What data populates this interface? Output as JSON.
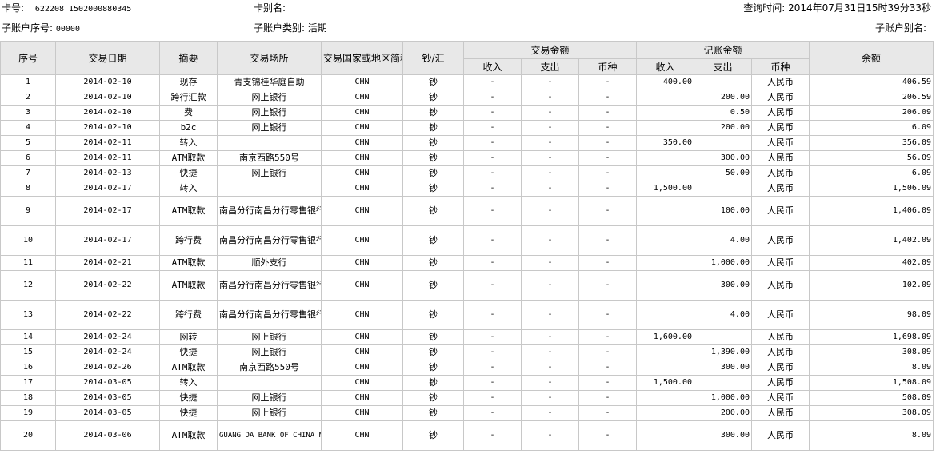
{
  "header": {
    "card_no_label": "卡号:",
    "card_no_value": "622208 1502000880345",
    "card_alias_label": "卡别名:",
    "card_alias_value": "",
    "query_time_label": "查询时间:",
    "query_time_value": "2014年07月31日15时39分33秒",
    "sub_account_no_label": "子账户序号:",
    "sub_account_no_value": "00000",
    "sub_account_type_label": "子账户类别:",
    "sub_account_type_value": "活期",
    "sub_account_alias_label": "子账户别名:",
    "sub_account_alias_value": ""
  },
  "columns": {
    "seq": "序号",
    "date": "交易日期",
    "summary": "摘要",
    "location": "交易场所",
    "country": "交易国家或地区简称",
    "cash_remit": "钞/汇",
    "trade_amount": "交易金额",
    "booked_amount": "记账金额",
    "income": "收入",
    "expense": "支出",
    "currency": "币种",
    "balance": "余额"
  },
  "rows": [
    {
      "seq": "1",
      "date": "2014-02-10",
      "summary": "现存",
      "location": "青支锦桂华庭自助",
      "country": "CHN",
      "cr": "钞",
      "t_in": "-",
      "t_out": "-",
      "t_cur": "-",
      "b_in": "400.00",
      "b_out": "",
      "b_cur": "人民币",
      "balance": "406.59",
      "tall": false
    },
    {
      "seq": "2",
      "date": "2014-02-10",
      "summary": "跨行汇款",
      "location": "网上银行",
      "country": "CHN",
      "cr": "钞",
      "t_in": "-",
      "t_out": "-",
      "t_cur": "-",
      "b_in": "",
      "b_out": "200.00",
      "b_cur": "人民币",
      "balance": "206.59",
      "tall": false
    },
    {
      "seq": "3",
      "date": "2014-02-10",
      "summary": "费",
      "location": "网上银行",
      "country": "CHN",
      "cr": "钞",
      "t_in": "-",
      "t_out": "-",
      "t_cur": "-",
      "b_in": "",
      "b_out": "0.50",
      "b_cur": "人民币",
      "balance": "206.09",
      "tall": false
    },
    {
      "seq": "4",
      "date": "2014-02-10",
      "summary": "b2c",
      "location": "网上银行",
      "country": "CHN",
      "cr": "钞",
      "t_in": "-",
      "t_out": "-",
      "t_cur": "-",
      "b_in": "",
      "b_out": "200.00",
      "b_cur": "人民币",
      "balance": "6.09",
      "tall": false
    },
    {
      "seq": "5",
      "date": "2014-02-11",
      "summary": "转入",
      "location": "",
      "country": "CHN",
      "cr": "钞",
      "t_in": "-",
      "t_out": "-",
      "t_cur": "-",
      "b_in": "350.00",
      "b_out": "",
      "b_cur": "人民币",
      "balance": "356.09",
      "tall": false
    },
    {
      "seq": "6",
      "date": "2014-02-11",
      "summary": "ATM取款",
      "location": "南京西路550号",
      "country": "CHN",
      "cr": "钞",
      "t_in": "-",
      "t_out": "-",
      "t_cur": "-",
      "b_in": "",
      "b_out": "300.00",
      "b_cur": "人民币",
      "balance": "56.09",
      "tall": false
    },
    {
      "seq": "7",
      "date": "2014-02-13",
      "summary": "快捷",
      "location": "网上银行",
      "country": "CHN",
      "cr": "钞",
      "t_in": "-",
      "t_out": "-",
      "t_cur": "-",
      "b_in": "",
      "b_out": "50.00",
      "b_cur": "人民币",
      "balance": "6.09",
      "tall": false
    },
    {
      "seq": "8",
      "date": "2014-02-17",
      "summary": "转入",
      "location": "",
      "country": "CHN",
      "cr": "钞",
      "t_in": "-",
      "t_out": "-",
      "t_cur": "-",
      "b_in": "1,500.00",
      "b_out": "",
      "b_cur": "人民币",
      "balance": "1,506.09",
      "tall": false
    },
    {
      "seq": "9",
      "date": "2014-02-17",
      "summary": "ATM取款",
      "location": "南昌分行南昌分行零售银行部恒立世纪经典小",
      "country": "CHN",
      "cr": "钞",
      "t_in": "-",
      "t_out": "-",
      "t_cur": "-",
      "b_in": "",
      "b_out": "100.00",
      "b_cur": "人民币",
      "balance": "1,406.09",
      "tall": true
    },
    {
      "seq": "10",
      "date": "2014-02-17",
      "summary": "跨行费",
      "location": "南昌分行南昌分行零售银行部恒立世纪经典小",
      "country": "CHN",
      "cr": "钞",
      "t_in": "-",
      "t_out": "-",
      "t_cur": "-",
      "b_in": "",
      "b_out": "4.00",
      "b_cur": "人民币",
      "balance": "1,402.09",
      "tall": true
    },
    {
      "seq": "11",
      "date": "2014-02-21",
      "summary": "ATM取款",
      "location": "顺外支行",
      "country": "CHN",
      "cr": "钞",
      "t_in": "-",
      "t_out": "-",
      "t_cur": "-",
      "b_in": "",
      "b_out": "1,000.00",
      "b_cur": "人民币",
      "balance": "402.09",
      "tall": false
    },
    {
      "seq": "12",
      "date": "2014-02-22",
      "summary": "ATM取款",
      "location": "南昌分行南昌分行零售银行部恒立世纪经典小",
      "country": "CHN",
      "cr": "钞",
      "t_in": "-",
      "t_out": "-",
      "t_cur": "-",
      "b_in": "",
      "b_out": "300.00",
      "b_cur": "人民币",
      "balance": "102.09",
      "tall": true
    },
    {
      "seq": "13",
      "date": "2014-02-22",
      "summary": "跨行费",
      "location": "南昌分行南昌分行零售银行部恒立世纪经典小",
      "country": "CHN",
      "cr": "钞",
      "t_in": "-",
      "t_out": "-",
      "t_cur": "-",
      "b_in": "",
      "b_out": "4.00",
      "b_cur": "人民币",
      "balance": "98.09",
      "tall": true
    },
    {
      "seq": "14",
      "date": "2014-02-24",
      "summary": "网转",
      "location": "网上银行",
      "country": "CHN",
      "cr": "钞",
      "t_in": "-",
      "t_out": "-",
      "t_cur": "-",
      "b_in": "1,600.00",
      "b_out": "",
      "b_cur": "人民币",
      "balance": "1,698.09",
      "tall": false
    },
    {
      "seq": "15",
      "date": "2014-02-24",
      "summary": "快捷",
      "location": "网上银行",
      "country": "CHN",
      "cr": "钞",
      "t_in": "-",
      "t_out": "-",
      "t_cur": "-",
      "b_in": "",
      "b_out": "1,390.00",
      "b_cur": "人民币",
      "balance": "308.09",
      "tall": false
    },
    {
      "seq": "16",
      "date": "2014-02-26",
      "summary": "ATM取款",
      "location": "南京西路550号",
      "country": "CHN",
      "cr": "钞",
      "t_in": "-",
      "t_out": "-",
      "t_cur": "-",
      "b_in": "",
      "b_out": "300.00",
      "b_cur": "人民币",
      "balance": "8.09",
      "tall": false
    },
    {
      "seq": "17",
      "date": "2014-03-05",
      "summary": "转入",
      "location": "",
      "country": "CHN",
      "cr": "钞",
      "t_in": "-",
      "t_out": "-",
      "t_cur": "-",
      "b_in": "1,500.00",
      "b_out": "",
      "b_cur": "人民币",
      "balance": "1,508.09",
      "tall": false
    },
    {
      "seq": "18",
      "date": "2014-03-05",
      "summary": "快捷",
      "location": "网上银行",
      "country": "CHN",
      "cr": "钞",
      "t_in": "-",
      "t_out": "-",
      "t_cur": "-",
      "b_in": "",
      "b_out": "1,000.00",
      "b_cur": "人民币",
      "balance": "508.09",
      "tall": false
    },
    {
      "seq": "19",
      "date": "2014-03-05",
      "summary": "快捷",
      "location": "网上银行",
      "country": "CHN",
      "cr": "钞",
      "t_in": "-",
      "t_out": "-",
      "t_cur": "-",
      "b_in": "",
      "b_out": "200.00",
      "b_cur": "人民币",
      "balance": "308.09",
      "tall": false
    },
    {
      "seq": "20",
      "date": "2014-03-06",
      "summary": "ATM取款",
      "location": "GUANG DA BANK OF CHINA NANCHANG CN",
      "country": "CHN",
      "cr": "钞",
      "t_in": "-",
      "t_out": "-",
      "t_cur": "-",
      "b_in": "",
      "b_out": "300.00",
      "b_cur": "人民币",
      "balance": "8.09",
      "tall": true
    }
  ]
}
